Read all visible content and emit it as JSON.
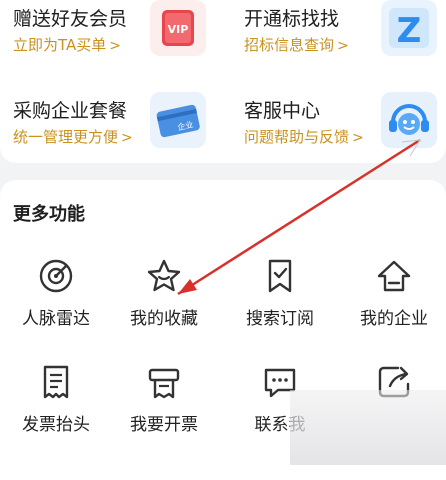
{
  "promos": [
    {
      "title": "赠送好友会员",
      "subtitle": "立即为TA买单",
      "badge": "VIP"
    },
    {
      "title": "开通标找找",
      "subtitle": "招标信息查询",
      "badge": "Z"
    },
    {
      "title": "采购企业套餐",
      "subtitle": "统一管理更方便",
      "badge": "企业"
    },
    {
      "title": "客服中心",
      "subtitle": "问题帮助与反馈",
      "badge": ""
    }
  ],
  "chevron": ">",
  "section_title": "更多功能",
  "functions": [
    {
      "label": "人脉雷达",
      "icon": "radar-icon"
    },
    {
      "label": "我的收藏",
      "icon": "star-icon"
    },
    {
      "label": "搜索订阅",
      "icon": "bookmark-check-icon"
    },
    {
      "label": "我的企业",
      "icon": "house-icon"
    },
    {
      "label": "发票抬头",
      "icon": "receipt-icon"
    },
    {
      "label": "我要开票",
      "icon": "printer-icon"
    },
    {
      "label": "联系我",
      "icon": "chat-icon"
    },
    {
      "label": "",
      "icon": "share-icon"
    }
  ],
  "colors": {
    "accent_gold": "#c9921f",
    "arrow_red": "#d8302a",
    "vip_red": "#e8454c",
    "z_blue": "#2d8cf0"
  }
}
